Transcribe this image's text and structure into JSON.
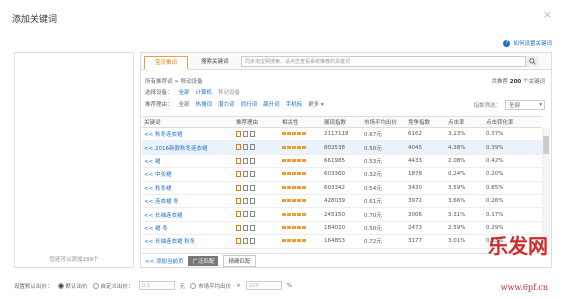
{
  "dialog": {
    "title": "添加关键词",
    "close_glyph": "×"
  },
  "help": {
    "icon_glyph": "?",
    "label": "如何设置关键词"
  },
  "tabs": [
    {
      "label": "宝贝推词"
    },
    {
      "label": "搜索关键词"
    }
  ],
  "search": {
    "placeholder": "同步淘宝网搜索，请点击查看系统推荐的关键词"
  },
  "info": {
    "text": "所有推荐词 > 移动设备",
    "total_prefix": "共推荐",
    "total_count": "200",
    "total_suffix": "个关键词"
  },
  "filter_device": {
    "label": "选择设备：",
    "options": [
      "全部",
      "计算机",
      "移动设备"
    ]
  },
  "filter_reason": {
    "label": "推荐理由：",
    "options": [
      "全部",
      "热搜词",
      "潜力词",
      "同行词",
      "飙升词",
      "手机标"
    ],
    "more": "更多"
  },
  "num_filter": {
    "label": "指数筛选：",
    "value": "全部"
  },
  "table": {
    "headers": [
      "关键词",
      "推荐理由",
      "相关性",
      "展现指数",
      "市场平均出价",
      "竞争指数",
      "点击率",
      "点击转化率"
    ],
    "rows": [
      {
        "kw": "<< 秋冬连衣裙",
        "impr": "2117118",
        "price": "0.67元",
        "comp": "6162",
        "ctr": "3.13%",
        "cvr": "0.37%"
      },
      {
        "kw": "<< 2016新款秋冬连衣裙",
        "impr": "802538",
        "price": "0.50元",
        "comp": "4045",
        "ctr": "4.38%",
        "cvr": "0.39%"
      },
      {
        "kw": "<< 裙",
        "impr": "661985",
        "price": "0.53元",
        "comp": "4433",
        "ctr": "2.08%",
        "cvr": "0.42%"
      },
      {
        "kw": "<< 中长裙",
        "impr": "603360",
        "price": "0.32元",
        "comp": "1878",
        "ctr": "0.24%",
        "cvr": "0.20%"
      },
      {
        "kw": "<< 秋冬裙",
        "impr": "603342",
        "price": "0.54元",
        "comp": "3430",
        "ctr": "3.59%",
        "cvr": "0.85%"
      },
      {
        "kw": "<< 连衣裙 冬",
        "impr": "428039",
        "price": "0.61元",
        "comp": "3972",
        "ctr": "3.66%",
        "cvr": "0.26%"
      },
      {
        "kw": "<< 长袖连衣裙",
        "impr": "245150",
        "price": "0.70元",
        "comp": "3006",
        "ctr": "3.31%",
        "cvr": "0.17%"
      },
      {
        "kw": "<< 裙 冬",
        "impr": "184020",
        "price": "0.50元",
        "comp": "2473",
        "ctr": "2.59%",
        "cvr": "0.29%"
      },
      {
        "kw": "<< 长袖连衣裙 秋冬",
        "impr": "164853",
        "price": "0.72元",
        "comp": "3177",
        "ctr": "3.01%",
        "cvr": "0.33%"
      }
    ]
  },
  "bottom": {
    "add_page": "<< 添加当前页",
    "btn_wide": "广泛匹配",
    "btn_exact": "精确匹配"
  },
  "left": {
    "hint": "您还可以添加189个"
  },
  "footer": {
    "label": "设置默认出价：",
    "opt1": "默认出价",
    "opt2": "自定义出价：",
    "custom_value": "0.1",
    "unit": "元",
    "opt3": "市场平均出价",
    "times": "×",
    "pct_value": "100",
    "pct": "%"
  },
  "watermark": {
    "text": "乐发网",
    "url": "www.6pf.cn"
  }
}
